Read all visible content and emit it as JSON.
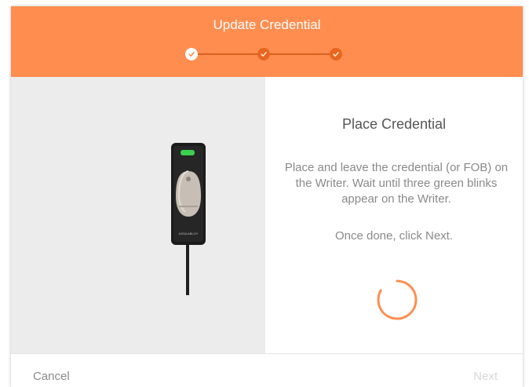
{
  "dialog": {
    "title": "Update Credential",
    "steps": [
      {
        "state": "done",
        "icon": "check-icon"
      },
      {
        "state": "done",
        "icon": "check-icon"
      },
      {
        "state": "done",
        "icon": "check-icon"
      }
    ]
  },
  "instructions": {
    "title": "Place Credential",
    "description": "Place and leave the credential (or FOB) on the Writer. Wait until three green blinks appear on the Writer.",
    "hint": "Once done, click Next."
  },
  "device": {
    "brand_text": "ASSA ABLOY",
    "led_color": "#3ccf4e"
  },
  "footer": {
    "cancel_label": "Cancel",
    "next_label": "Next"
  },
  "colors": {
    "header": "#ff8d4f",
    "accent": "#ff8d4f",
    "step_pending": "#e8661f"
  }
}
